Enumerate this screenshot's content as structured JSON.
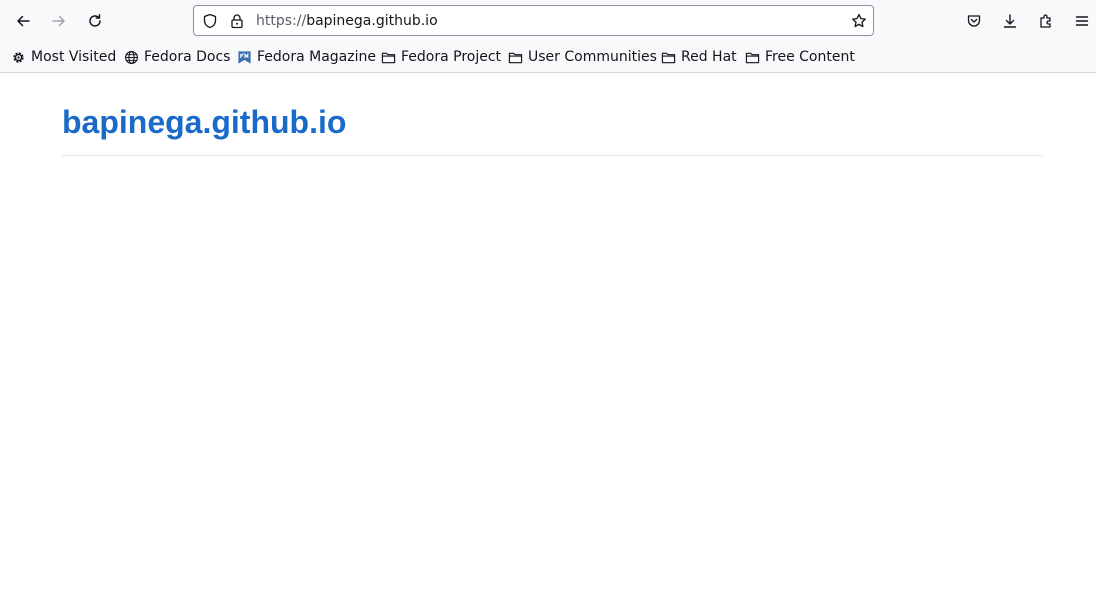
{
  "browser": {
    "url_scheme": "https://",
    "url_host": "bapinega.github.io"
  },
  "bookmarks": [
    {
      "label": "Most Visited",
      "icon": "gear-icon"
    },
    {
      "label": "Fedora Docs",
      "icon": "globe-icon"
    },
    {
      "label": "Fedora Magazine",
      "icon": "fedora-magazine-icon"
    },
    {
      "label": "Fedora Project",
      "icon": "folder-icon"
    },
    {
      "label": "User Communities",
      "icon": "folder-icon"
    },
    {
      "label": "Red Hat",
      "icon": "folder-icon"
    },
    {
      "label": "Free Content",
      "icon": "folder-icon"
    }
  ],
  "page": {
    "site_title": "bapinega.github.io"
  },
  "colors": {
    "link": "#1a6ac9",
    "chrome_bg": "#f9f9fb"
  }
}
